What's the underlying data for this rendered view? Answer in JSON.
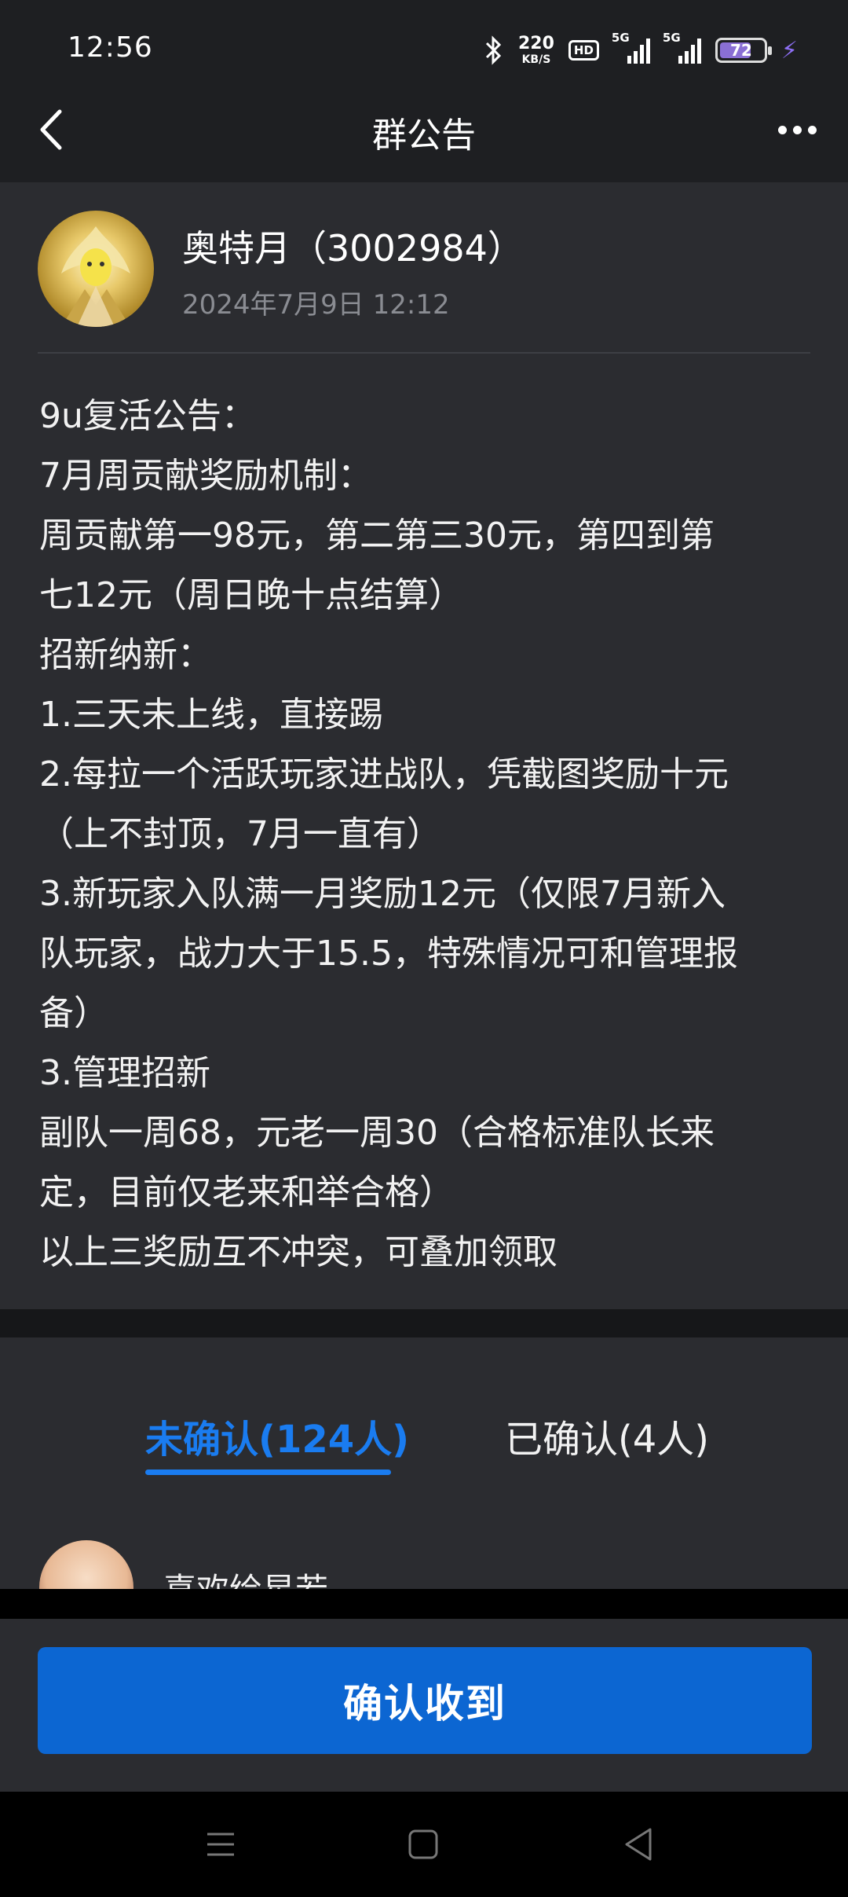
{
  "status_bar": {
    "time": "12:56",
    "net_speed_value": "220",
    "net_speed_unit": "KB/S",
    "hd_label": "HD",
    "signal1_label": "5G",
    "signal2_label": "5G",
    "battery_level": "72",
    "battery_fraction": 0.72,
    "battery_color": "#8a6fd4"
  },
  "title_bar": {
    "title": "群公告",
    "back_icon": "chevron-left-icon",
    "more_icon": "more-dots-icon"
  },
  "announcement": {
    "author": "奥特月（3002984）",
    "posted_at": "2024年7月9日 12:12",
    "lines": [
      "9u复活公告：",
      "7月周贡献奖励机制：",
      "周贡献第一98元，第二第三30元，第四到第",
      "七12元（周日晚十点结算）",
      "招新纳新：",
      "1.三天未上线，直接踢",
      "2.每拉一个活跃玩家进战队，凭截图奖励十元",
      "（上不封顶，7月一直有）",
      "3.新玩家入队满一月奖励12元（仅限7月新入",
      "队玩家，战力大于15.5，特殊情况可和管理报",
      "备）",
      "3.管理招新",
      "副队一周68，元老一周30（合格标准队长来",
      "定，目前仅老来和举合格）",
      "以上三奖励互不冲突，可叠加领取"
    ]
  },
  "tabs": {
    "unconfirmed": "未确认(124人)",
    "confirmed": "已确认(4人)",
    "active": "unconfirmed",
    "active_color": "#1a7cf0"
  },
  "member_list": {
    "first_member_name": "喜欢绘星若"
  },
  "footer": {
    "confirm_label": "确认收到",
    "button_color": "#0c66d2"
  },
  "nav_bar": {
    "menu_icon": "menu-lines-icon",
    "home_icon": "home-square-icon",
    "back_icon": "back-triangle-icon"
  }
}
